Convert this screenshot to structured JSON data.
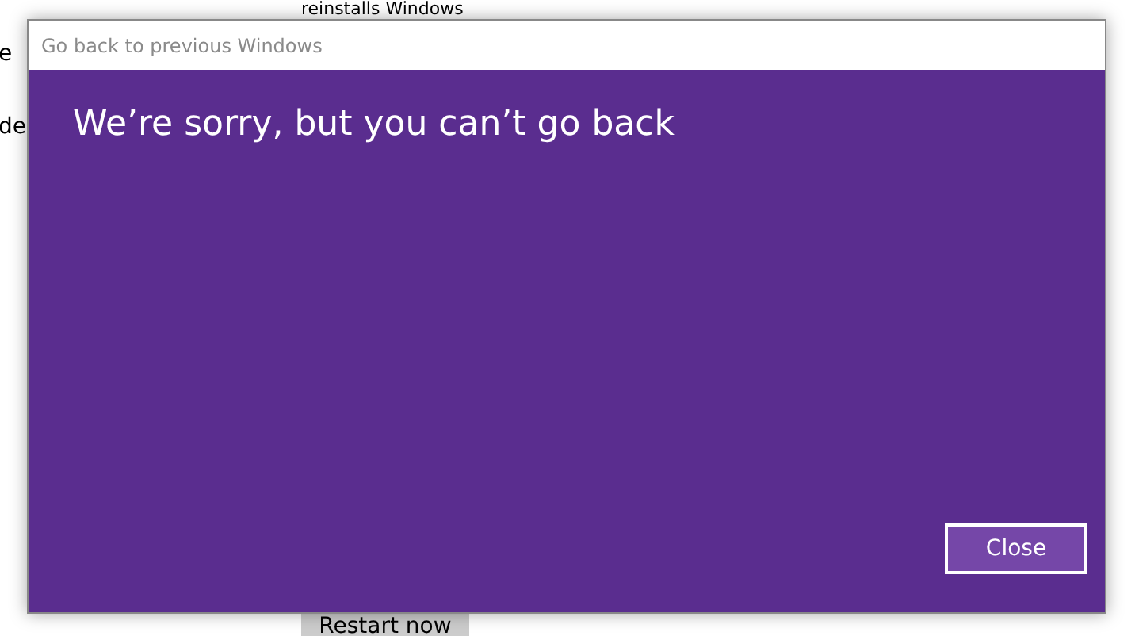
{
  "background": {
    "left_texts": [
      "e",
      "de"
    ],
    "top_text": "reinstalls Windows",
    "button": "Restart now"
  },
  "dialog": {
    "title": "Go back to previous Windows",
    "heading": "We’re sorry, but you can’t go back",
    "buttons": [
      "Close"
    ]
  }
}
